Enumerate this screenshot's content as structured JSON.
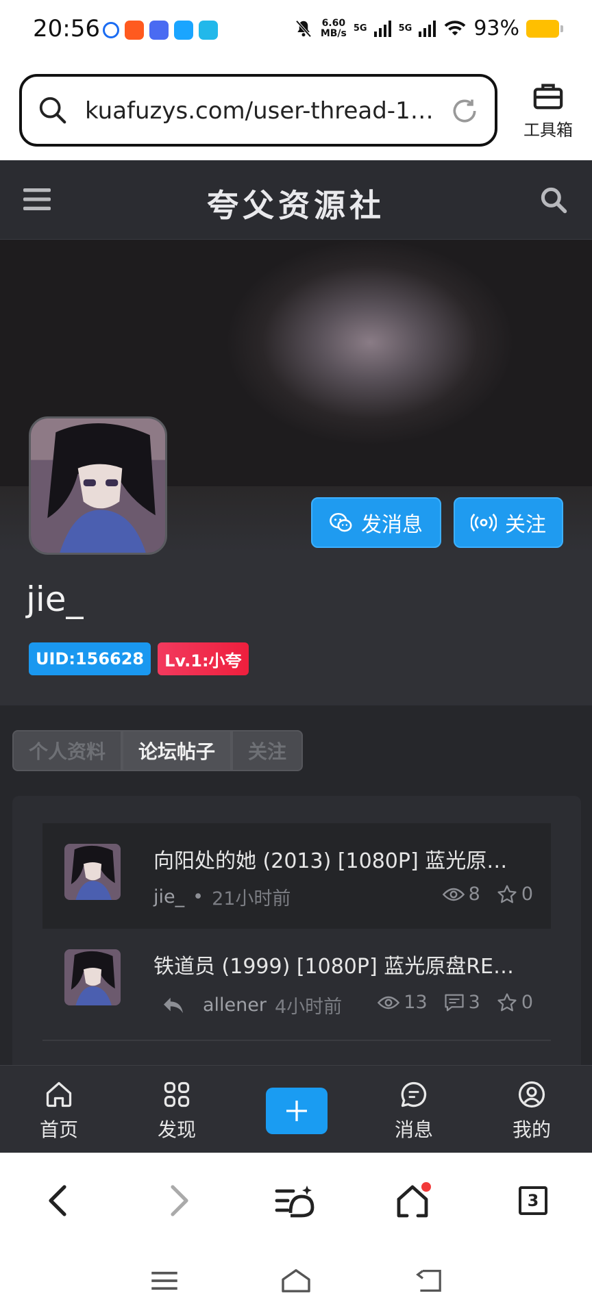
{
  "status_bar": {
    "time": "20:56",
    "net_speed": "6.60",
    "net_unit": "MB/s",
    "sig1": "5G",
    "sig2": "5G",
    "battery": "93%",
    "app_icons": [
      "#1b6cf2",
      "#ff5a1f",
      "#4a6bf2",
      "#1aa5ff",
      "#22b8ea"
    ]
  },
  "browser": {
    "url": "kuafuzys.com/user-thread-1…",
    "toolbox_label": "工具箱",
    "tab_count": "3"
  },
  "site": {
    "logo": "夸父资源社"
  },
  "profile": {
    "username": "jie_",
    "uid_badge": "UID:156628",
    "level_badge": "Lv.1:小夸",
    "message_button": "发消息",
    "follow_button": "关注"
  },
  "tabs": [
    {
      "label": "个人资料",
      "active": false
    },
    {
      "label": "论坛帖子",
      "active": true
    },
    {
      "label": "关注",
      "active": false
    }
  ],
  "posts": [
    {
      "title": "向阳处的她 (2013) [1080P] 蓝光原…",
      "author": "jie_",
      "separator": "•",
      "time": "21小时前",
      "views": "8",
      "stars": "0"
    },
    {
      "title": "铁道员 (1999) [1080P] 蓝光原盘RE…",
      "author": "allener",
      "time": "4小时前",
      "views": "13",
      "comments": "3",
      "stars": "0"
    }
  ],
  "site_nav": [
    {
      "label": "首页",
      "icon": "home-icon"
    },
    {
      "label": "发现",
      "icon": "grid-icon"
    },
    {
      "label": "消息",
      "icon": "chat-icon"
    },
    {
      "label": "我的",
      "icon": "user-icon"
    }
  ],
  "colors": {
    "accent": "#1a9cf2",
    "level_badge": "#ee1f3d",
    "dark_bg": "#2b2c31"
  }
}
